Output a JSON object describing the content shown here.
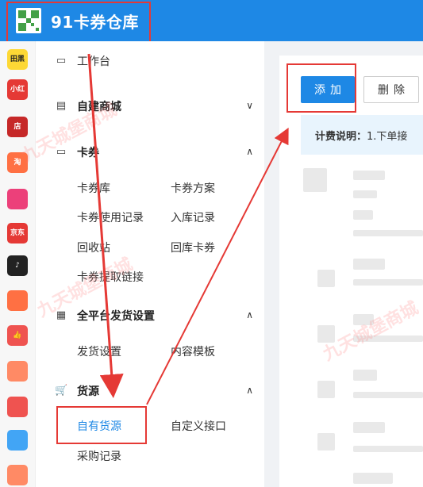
{
  "header": {
    "title": "91卡券仓库",
    "logo_icon": "qr-logo-icon",
    "accent_color": "#1e88e5"
  },
  "app_bar": {
    "icons": [
      {
        "name": "app-icon-1",
        "label": "田黑",
        "color": "#fdd835",
        "text_color": "#222"
      },
      {
        "name": "app-icon-xiaohongshu",
        "label": "小红书",
        "color": "#e53935",
        "text_color": "#fff"
      },
      {
        "name": "app-icon-shop",
        "label": "店",
        "color": "#c62828",
        "text_color": "#fff"
      },
      {
        "name": "app-icon-taobao",
        "label": "淘",
        "color": "#ff7043",
        "text_color": "#fff"
      },
      {
        "name": "app-icon-flower",
        "label": "",
        "color": "#ec407a",
        "text_color": "#fff"
      },
      {
        "name": "app-icon-jd",
        "label": "京东",
        "color": "#e53935",
        "text_color": "#fff"
      },
      {
        "name": "app-icon-douyin",
        "label": "♪",
        "color": "#222222",
        "text_color": "#fff"
      },
      {
        "name": "app-icon-kuaishou",
        "label": "",
        "color": "#ff7043",
        "text_color": "#fff"
      },
      {
        "name": "app-icon-thumb",
        "label": "👍",
        "color": "#ef5350",
        "text_color": "#fff"
      },
      {
        "name": "app-icon-bag",
        "label": "",
        "color": "#ff8a65",
        "text_color": "#fff"
      },
      {
        "name": "app-icon-shopee",
        "label": "",
        "color": "#ef5350",
        "text_color": "#fff"
      },
      {
        "name": "app-icon-link",
        "label": "",
        "color": "#42a5f5",
        "text_color": "#fff"
      },
      {
        "name": "app-icon-gift",
        "label": "",
        "color": "#ff8a65",
        "text_color": "#fff"
      }
    ]
  },
  "menu": {
    "workbench": "工作台",
    "mall": "自建商城",
    "coupons": {
      "label": "卡券",
      "items": [
        "卡券库",
        "卡券方案",
        "卡券使用记录",
        "入库记录",
        "回收站",
        "回库卡券",
        "卡券提取链接"
      ]
    },
    "shipping": {
      "label": "全平台发货设置",
      "items": [
        "发货设置",
        "内容模板"
      ]
    },
    "supply": {
      "label": "货源",
      "items": [
        "自有货源",
        "自定义接口",
        "采购记录"
      ]
    }
  },
  "toolbar": {
    "add_label": "添加",
    "delete_label": "删除"
  },
  "notice": {
    "label": "计费说明：",
    "text": "1.下单接"
  },
  "watermark_text": "九天城堡商城",
  "annotation_color": "#e53935"
}
